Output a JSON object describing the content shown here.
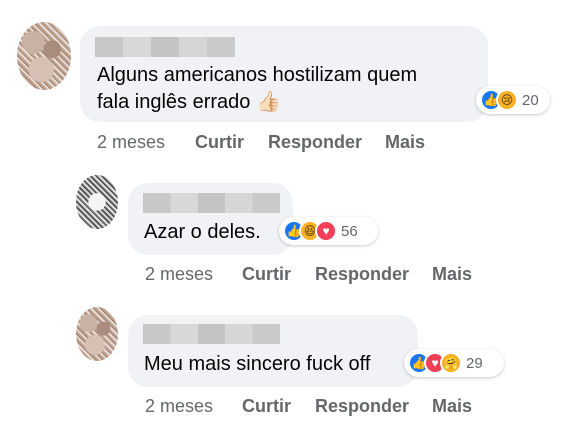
{
  "comments": [
    {
      "text_lines": [
        "Alguns americanos hostilizam quem",
        "fala inglês errado"
      ],
      "emoji": "👍🏻",
      "reactions": [
        "like",
        "sad"
      ],
      "reaction_count": "20",
      "time": "2 meses",
      "like_label": "Curtir",
      "reply_label": "Responder",
      "more_label": "Mais"
    },
    {
      "text_lines": [
        "Azar o deles."
      ],
      "reactions": [
        "like",
        "haha",
        "love"
      ],
      "reaction_count": "56",
      "time": "2 meses",
      "like_label": "Curtir",
      "reply_label": "Responder",
      "more_label": "Mais"
    },
    {
      "text_lines": [
        "Meu mais sincero fuck off"
      ],
      "reactions": [
        "like",
        "love",
        "care"
      ],
      "reaction_count": "29",
      "time": "2 meses",
      "like_label": "Curtir",
      "reply_label": "Responder",
      "more_label": "Mais"
    }
  ],
  "icons": {
    "like": "👍",
    "sad": "😢",
    "haha": "😆",
    "love": "♥",
    "care": "🤗"
  }
}
